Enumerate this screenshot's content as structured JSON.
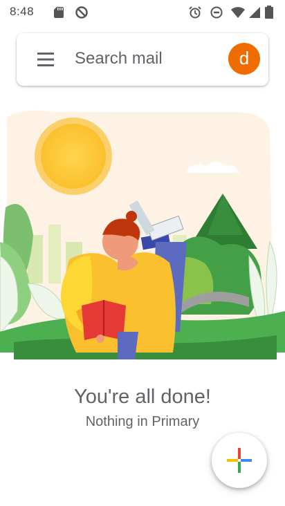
{
  "status_bar": {
    "time": "8:48",
    "icons": [
      "sd-card-icon",
      "no-disturb-circle-icon",
      "alarm-icon",
      "dnd-minus-icon",
      "wifi-icon",
      "signal-icon",
      "battery-icon"
    ]
  },
  "search": {
    "placeholder": "Search mail"
  },
  "account": {
    "avatar_letter": "d",
    "avatar_color": "#ef6c00"
  },
  "empty_state": {
    "title": "You're all done!",
    "subtitle": "Nothing in Primary"
  },
  "fab": {
    "icon": "compose-plus-icon"
  },
  "colors": {
    "text_gray": "#5f6368",
    "plus_red": "#ea4335",
    "plus_blue": "#4285f4",
    "plus_green": "#34a853",
    "plus_yellow": "#fbbc04"
  }
}
